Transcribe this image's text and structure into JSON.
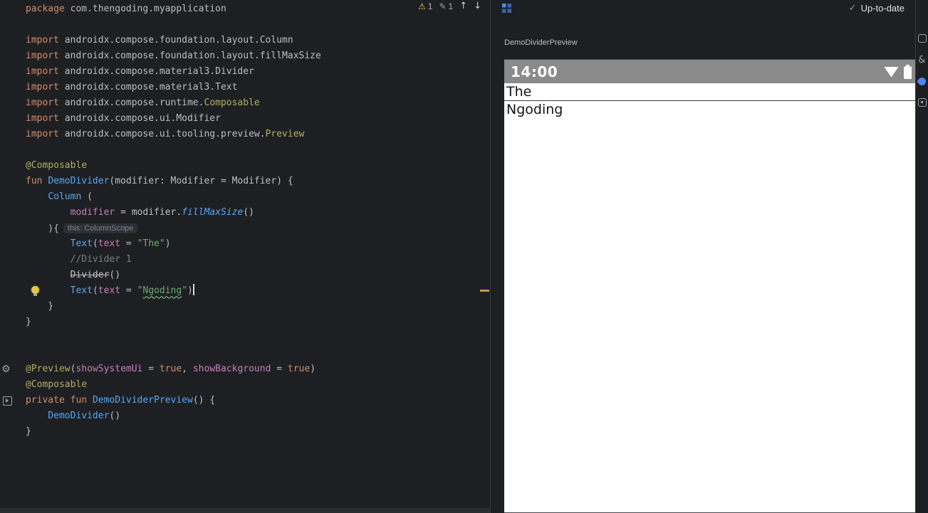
{
  "colors": {
    "editor_bg": "#1e1f22",
    "keyword": "#cf8e6d",
    "function": "#56a8f5",
    "string": "#6aab73",
    "annotation": "#b3ae60",
    "parameter": "#c77dbb",
    "comment": "#7a7e85",
    "change_marker": "#c8973f",
    "statusbar_gray": "#8a8a8a",
    "check_green": "#5fb865",
    "accent_blue": "#4a88f7"
  },
  "editor": {
    "inspections": {
      "warnings": "1",
      "typos": "1"
    },
    "code": [
      {
        "tokens": [
          [
            "kw",
            "package"
          ],
          [
            "pl",
            " com.thengoding.myapplication"
          ]
        ]
      },
      {
        "tokens": []
      },
      {
        "tokens": [
          [
            "kw",
            "import"
          ],
          [
            "pl",
            " androidx.compose.foundation.layout.Column"
          ]
        ]
      },
      {
        "tokens": [
          [
            "kw",
            "import"
          ],
          [
            "pl",
            " androidx.compose.foundation.layout.fillMaxSize"
          ]
        ]
      },
      {
        "tokens": [
          [
            "kw",
            "import"
          ],
          [
            "pl",
            " androidx.compose.material3.Divider"
          ]
        ]
      },
      {
        "tokens": [
          [
            "kw",
            "import"
          ],
          [
            "pl",
            " androidx.compose.material3.Text"
          ]
        ]
      },
      {
        "tokens": [
          [
            "kw",
            "import"
          ],
          [
            "pl",
            " androidx.compose.runtime."
          ],
          [
            "ann",
            "Composable"
          ]
        ]
      },
      {
        "tokens": [
          [
            "kw",
            "import"
          ],
          [
            "pl",
            " androidx.compose.ui.Modifier"
          ]
        ]
      },
      {
        "tokens": [
          [
            "kw",
            "import"
          ],
          [
            "pl",
            " androidx.compose.ui.tooling.preview."
          ],
          [
            "ann",
            "Preview"
          ]
        ]
      },
      {
        "tokens": []
      },
      {
        "tokens": [
          [
            "ann",
            "@Composable"
          ]
        ]
      },
      {
        "tokens": [
          [
            "kw",
            "fun"
          ],
          [
            "pl",
            " "
          ],
          [
            "fn",
            "DemoDivider"
          ],
          [
            "pl",
            "(modifier: Modifier = Modifier) {"
          ]
        ]
      },
      {
        "tokens": [
          [
            "pl",
            "    "
          ],
          [
            "fn",
            "Column"
          ],
          [
            "pl",
            " ("
          ]
        ]
      },
      {
        "tokens": [
          [
            "pl",
            "        "
          ],
          [
            "prm",
            "modifier"
          ],
          [
            "pl",
            " = modifier."
          ],
          [
            "fni",
            "fillMaxSize"
          ],
          [
            "pl",
            "()"
          ]
        ]
      },
      {
        "tokens": [
          [
            "pl",
            "    ){"
          ]
        ],
        "hint": "this: ColumnScope"
      },
      {
        "tokens": [
          [
            "pl",
            "        "
          ],
          [
            "fn",
            "Text"
          ],
          [
            "pl",
            "("
          ],
          [
            "prm",
            "text"
          ],
          [
            "pl",
            " = "
          ],
          [
            "str",
            "\"The\""
          ],
          [
            "pl",
            ")"
          ]
        ]
      },
      {
        "tokens": [
          [
            "pl",
            "        "
          ],
          [
            "cmt",
            "//Divider 1"
          ]
        ]
      },
      {
        "tokens": [
          [
            "pl",
            "        "
          ],
          [
            "dep",
            "Divider"
          ],
          [
            "pl",
            "()"
          ]
        ]
      },
      {
        "tokens": [
          [
            "pl",
            "        "
          ],
          [
            "fn",
            "Text"
          ],
          [
            "pl",
            "("
          ],
          [
            "prm",
            "text"
          ],
          [
            "pl",
            " = "
          ],
          [
            "str",
            "\""
          ],
          [
            "strT",
            "Ngoding"
          ],
          [
            "str",
            "\""
          ],
          [
            "pl",
            ")"
          ]
        ],
        "bulb": true,
        "caret": true,
        "mark": true
      },
      {
        "tokens": [
          [
            "pl",
            "    }"
          ]
        ]
      },
      {
        "tokens": [
          [
            "pl",
            "}"
          ]
        ]
      },
      {
        "tokens": []
      },
      {
        "tokens": []
      },
      {
        "tokens": [
          [
            "ann",
            "@Preview"
          ],
          [
            "pl",
            "("
          ],
          [
            "prm",
            "showSystemUi"
          ],
          [
            "pl",
            " = "
          ],
          [
            "kw",
            "true"
          ],
          [
            "pl",
            ", "
          ],
          [
            "prm",
            "showBackground"
          ],
          [
            "pl",
            " = "
          ],
          [
            "kw",
            "true"
          ],
          [
            "pl",
            ")"
          ]
        ],
        "gutter": "gear-icon"
      },
      {
        "tokens": [
          [
            "ann",
            "@Composable"
          ]
        ]
      },
      {
        "tokens": [
          [
            "kw",
            "private"
          ],
          [
            "pl",
            " "
          ],
          [
            "kw",
            "fun"
          ],
          [
            "pl",
            " "
          ],
          [
            "fn",
            "DemoDividerPreview"
          ],
          [
            "pl",
            "() {"
          ]
        ],
        "gutter": "run-preview-icon"
      },
      {
        "tokens": [
          [
            "pl",
            "    "
          ],
          [
            "fn",
            "DemoDivider"
          ],
          [
            "pl",
            "()"
          ]
        ]
      },
      {
        "tokens": [
          [
            "pl",
            "}"
          ]
        ]
      }
    ]
  },
  "preview_panel": {
    "status": "Up-to-date",
    "preview_label": "DemoDividerPreview",
    "device": {
      "clock": "14:00",
      "line1": "The",
      "line2": "Ngoding"
    }
  },
  "tool_stripe": {
    "icons": [
      {
        "name": "device-manager-icon",
        "glyph": ""
      },
      {
        "name": "gradle-icon",
        "glyph": "&"
      },
      {
        "name": "compose-preview-icon",
        "glyph": ""
      },
      {
        "name": "emulator-icon",
        "glyph": ""
      }
    ]
  }
}
